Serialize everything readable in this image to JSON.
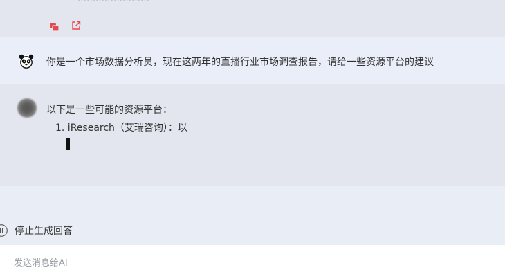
{
  "conversation": {
    "previous_answer": {
      "cut_off_text": "……………………",
      "actions": [
        {
          "icon": "copy-icon",
          "color": "#e5484d"
        },
        {
          "icon": "share-icon",
          "color": "#e5484d"
        }
      ]
    },
    "user_message": {
      "avatar": "panda-avatar",
      "text": "你是一个市场数据分析员，现在这两年的直播行业市场调查报告，请给一些资源平台的建议"
    },
    "ai_message": {
      "avatar": "ai-avatar",
      "intro": "以下是一些可能的资源平台：",
      "items": [
        "1. iResearch（艾瑞咨询）：以"
      ],
      "streaming": true
    }
  },
  "controls": {
    "stop_label": "停止生成回答"
  },
  "composer": {
    "placeholder": "发送消息给AI"
  },
  "colors": {
    "accent": "#e5484d",
    "panel_bg": "#e3e6ee",
    "user_bg": "#e9eef8",
    "page_bg": "#e9edf6"
  }
}
